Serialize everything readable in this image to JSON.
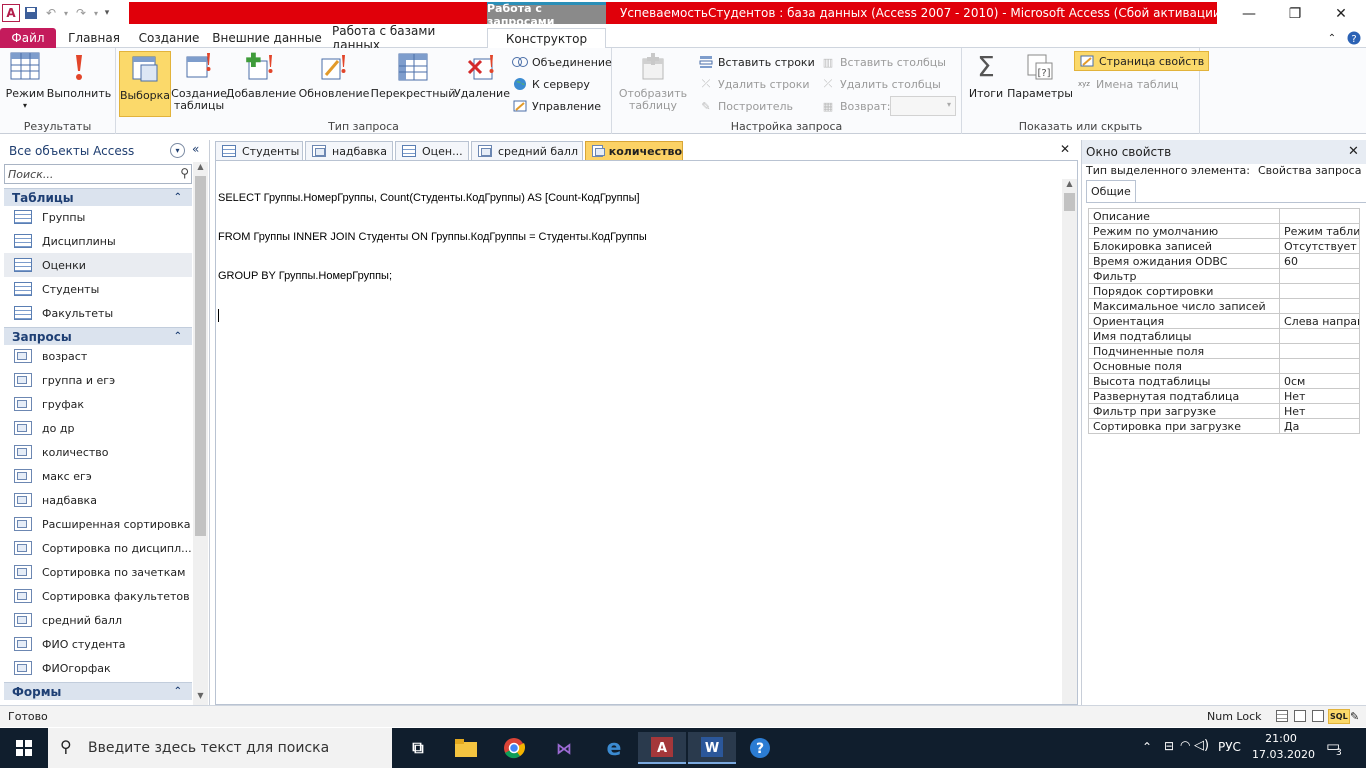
{
  "titlebar": {
    "context_tab": "Работа с запросами",
    "title": "УспеваемостьСтудентов : база данных (Access 2007 - 2010)  -  Microsoft Access (Сбой активации продукта)",
    "app_icon_letter": "A"
  },
  "ribbon_tabs": [
    "Файл",
    "Главная",
    "Создание",
    "Внешние данные",
    "Работа с базами данных",
    "Конструктор"
  ],
  "ribbon": {
    "results": {
      "label": "Результаты",
      "mode": "Режим",
      "run": "Выполнить"
    },
    "query_type": {
      "label": "Тип запроса",
      "select": "Выборка",
      "make_table": "Создание таблицы",
      "append": "Добавление",
      "update": "Обновление",
      "crosstab": "Перекрестный",
      "delete": "Удаление",
      "union": "Объединение",
      "pass_through": "К серверу",
      "data_definition": "Управление"
    },
    "setup": {
      "label": "Настройка запроса",
      "show_table": "Отобразить таблицу",
      "insert_rows": "Вставить строки",
      "delete_rows": "Удалить строки",
      "builder": "Построитель",
      "insert_columns": "Вставить столбцы",
      "delete_columns": "Удалить столбцы",
      "return": "Возврат:"
    },
    "show_hide": {
      "label": "Показать или скрыть",
      "totals": "Итоги",
      "parameters": "Параметры",
      "property_sheet": "Страница свойств",
      "table_names": "Имена таблиц"
    }
  },
  "nav": {
    "header": "Все объекты Access",
    "search_placeholder": "Поиск...",
    "sections": [
      {
        "title": "Таблицы",
        "items": [
          "Группы",
          "Дисциплины",
          "Оценки",
          "Студенты",
          "Факультеты"
        ]
      },
      {
        "title": "Запросы",
        "items": [
          "возраст",
          "группа и егэ",
          "груфак",
          "до др",
          "количество",
          "макс егэ",
          "надбавка",
          "Расширенная сортировка",
          "Сортировка по дисципл...",
          "Сортировка по зачеткам",
          "Сортировка факультетов",
          "средний балл",
          "ФИО студента",
          "ФИОгорфак"
        ]
      },
      {
        "title": "Формы",
        "items": []
      }
    ]
  },
  "doc_tabs": [
    "Студенты",
    "надбавка",
    "Оцен...",
    "средний балл",
    "количество"
  ],
  "sql_lines": [
    "SELECT Группы.НомерГруппы, Count(Студенты.КодГруппы) AS [Count-КодГруппы]",
    "FROM Группы INNER JOIN Студенты ON Группы.КодГруппы = Студенты.КодГруппы",
    "GROUP BY Группы.НомерГруппы;"
  ],
  "property_sheet": {
    "title": "Окно свойств",
    "selection_type_label": "Тип выделенного элемента:",
    "selection_type_value": "Свойства запроса",
    "tab": "Общие",
    "rows": [
      {
        "name": "Описание",
        "value": ""
      },
      {
        "name": "Режим по умолчанию",
        "value": "Режим таблиц"
      },
      {
        "name": "Блокировка записей",
        "value": "Отсутствует"
      },
      {
        "name": "Время ожидания ODBC",
        "value": "60"
      },
      {
        "name": "Фильтр",
        "value": ""
      },
      {
        "name": "Порядок сортировки",
        "value": ""
      },
      {
        "name": "Максимальное число записей",
        "value": ""
      },
      {
        "name": "Ориентация",
        "value": "Слева направо"
      },
      {
        "name": "Имя подтаблицы",
        "value": ""
      },
      {
        "name": "Подчиненные поля",
        "value": ""
      },
      {
        "name": "Основные поля",
        "value": ""
      },
      {
        "name": "Высота подтаблицы",
        "value": "0см"
      },
      {
        "name": "Развернутая подтаблица",
        "value": "Нет"
      },
      {
        "name": "Фильтр при загрузке",
        "value": "Нет"
      },
      {
        "name": "Сортировка при загрузке",
        "value": "Да"
      }
    ]
  },
  "status": {
    "left": "Готово",
    "numlock": "Num Lock",
    "sql_badge": "SQL"
  },
  "taskbar": {
    "search_placeholder": "Введите здесь текст для поиска",
    "lang": "РУС",
    "time": "21:00",
    "date": "17.03.2020",
    "notifications": "3"
  }
}
